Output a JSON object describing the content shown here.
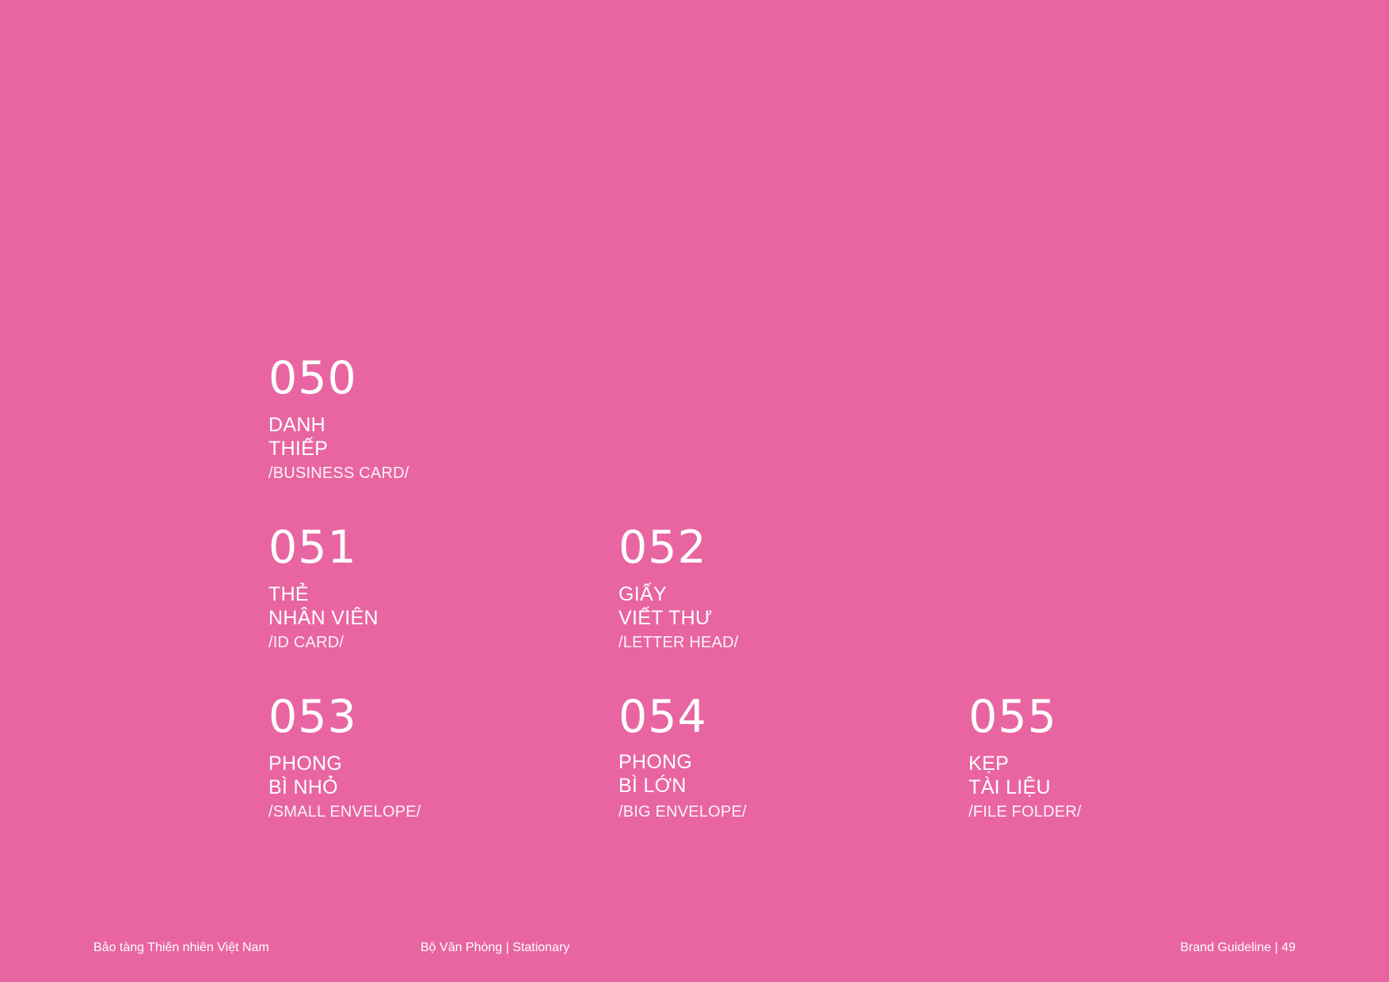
{
  "items": [
    {
      "number": "050",
      "title_line1": "DANH",
      "title_line2": "THIẾP",
      "subtitle": "/BUSINESS CARD/"
    },
    {
      "number": "051",
      "title_line1": "THẺ",
      "title_line2": "NHÂN VIÊN",
      "subtitle": "/ID CARD/"
    },
    {
      "number": "052",
      "title_line1": "GIẤY",
      "title_line2": "VIẾT THƯ",
      "subtitle": "/LETTER HEAD/"
    },
    {
      "number": "053",
      "title_line1": "PHONG",
      "title_line2": "BÌ NHỎ",
      "subtitle": "/SMALL ENVELOPE/"
    },
    {
      "number": "054",
      "title_line1": "PHONG",
      "title_line2": "BÌ LỚN",
      "subtitle": "/BIG ENVELOPE/"
    },
    {
      "number": "055",
      "title_line1": "KẸP",
      "title_line2": "TÀI LIỆU",
      "subtitle": "/FILE FOLDER/"
    }
  ],
  "footer": {
    "organization": "Bảo tàng Thiên nhiên Việt Nam",
    "section": "Bộ Văn Phòng | Stationary",
    "page": "Brand Guideline | 49"
  },
  "colors": {
    "background": "#e865a2",
    "text": "#ffffff"
  }
}
